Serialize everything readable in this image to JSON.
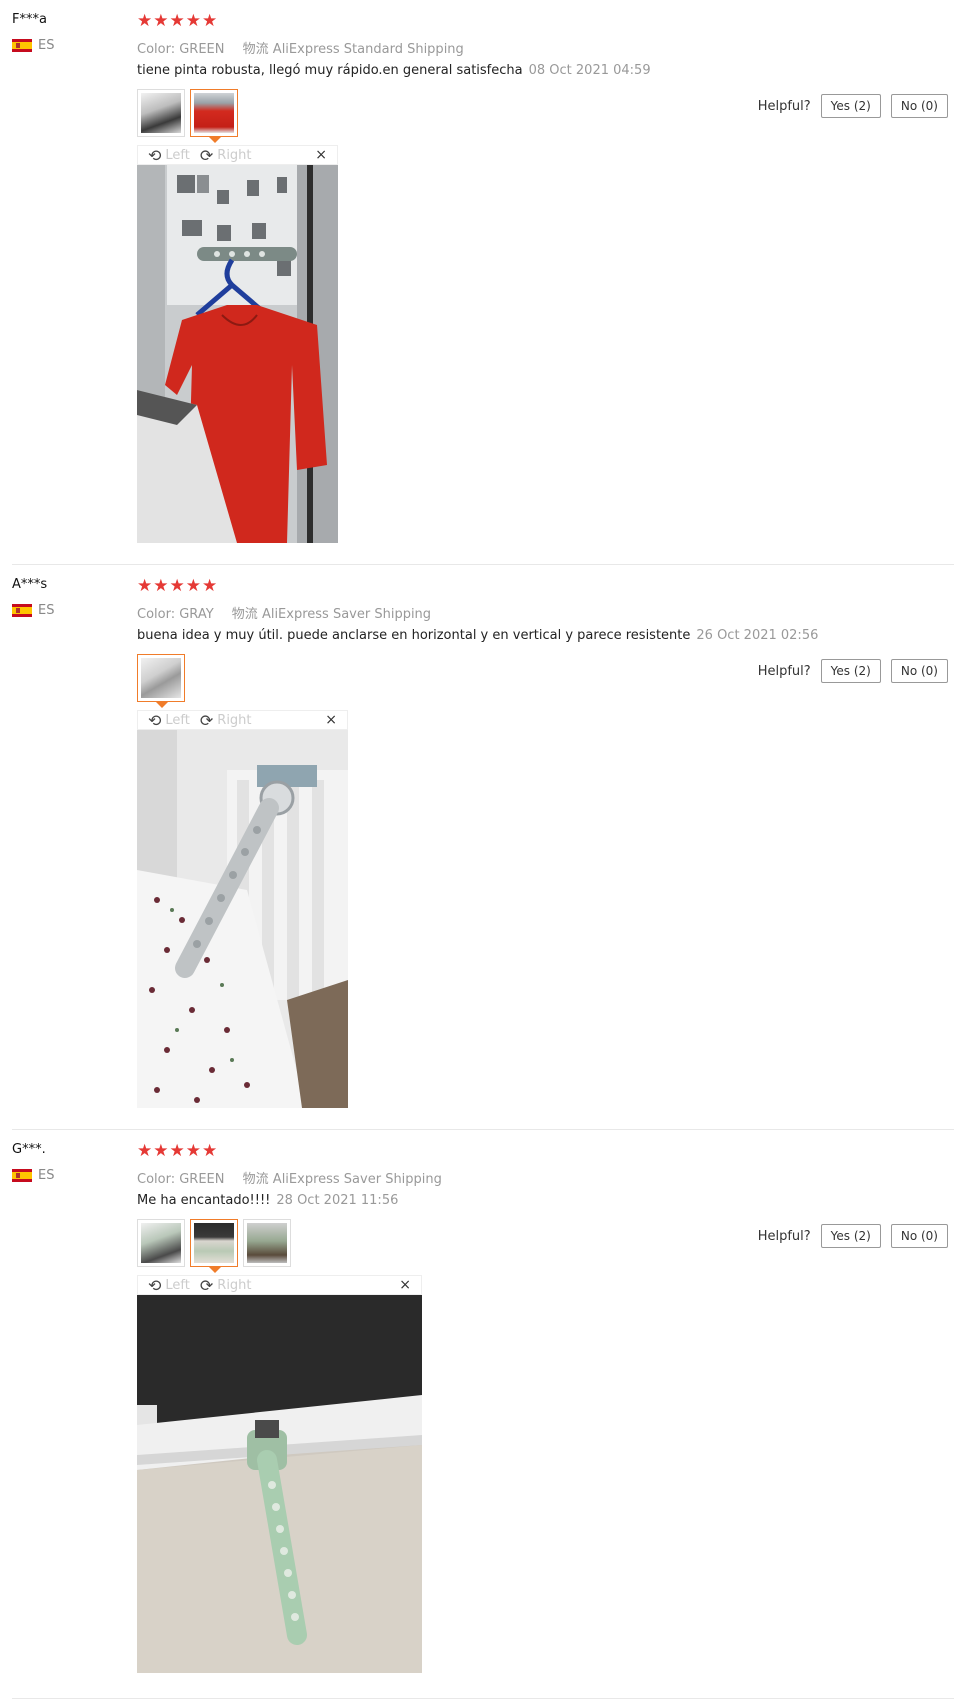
{
  "labels": {
    "color_key": "Color:",
    "shipping_prefix": "物流",
    "helpful": "Helpful?",
    "rotate_left": "Left",
    "rotate_right": "Right",
    "close": "×",
    "star": "★"
  },
  "reviews": [
    {
      "user": "F***a",
      "country": "ES",
      "rating": 5,
      "color": "GREEN",
      "shipping": "AliExpress Standard Shipping",
      "comment": "tiene pinta robusta, llegó muy rápido.en general satisfecha",
      "date": "08 Oct 2021 04:59",
      "yes": "Yes (2)",
      "no": "No (0)"
    },
    {
      "user": "A***s",
      "country": "ES",
      "rating": 5,
      "color": "GRAY",
      "shipping": "AliExpress Saver Shipping",
      "comment": "buena idea y muy útil. puede anclarse en horizontal y en vertical y parece resistente",
      "date": "26 Oct 2021 02:56",
      "yes": "Yes (2)",
      "no": "No (0)"
    },
    {
      "user": "G***.",
      "country": "ES",
      "rating": 5,
      "color": "GREEN",
      "shipping": "AliExpress Saver Shipping",
      "comment": "Me ha encantado!!!!",
      "date": "28 Oct 2021 11:56",
      "yes": "Yes (2)",
      "no": "No (0)"
    }
  ]
}
